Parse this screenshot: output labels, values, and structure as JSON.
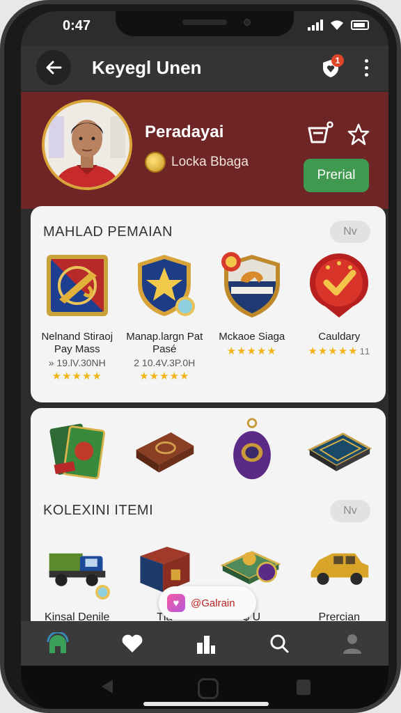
{
  "status": {
    "time": "0:47"
  },
  "appbar": {
    "title": "Keyegl Unen",
    "notification_count": "1"
  },
  "profile": {
    "name": "Peradayai",
    "coin_label": "Locka Bbaga",
    "premium_button": "Prerial"
  },
  "section1": {
    "title": "MAHLAD PEMAIAN",
    "toggle": "Nv",
    "items": [
      {
        "name": "Nelnand Stiraoj Pay Mass",
        "price": "» 19.lV.30NH",
        "stars": "★★★★★",
        "count": "",
        "icon": "saxophone-badge-icon"
      },
      {
        "name": "Manap.largn Pat Pasé",
        "price": "2 10.4V.3P.0H",
        "stars": "★★★★★",
        "count": "",
        "icon": "star-shield-icon"
      },
      {
        "name": "Mckaoe Siaga",
        "price": "",
        "stars": "★★★★★",
        "count": "",
        "icon": "crest-shield-icon"
      },
      {
        "name": "Cauldary",
        "price": "",
        "stars": "★★★★★",
        "count": "11",
        "icon": "check-badge-icon"
      }
    ]
  },
  "section2": {
    "title": "KOLEXINI ITEMI",
    "toggle": "Nv",
    "top_icons": [
      "card-pack-icon",
      "leather-book-icon",
      "purple-egg-icon",
      "board-game-icon"
    ],
    "bottom_icons": [
      "truck-icon",
      "treasure-box-icon",
      "money-stack-icon",
      "gold-car-icon"
    ],
    "bottom_names": [
      "Kinsal Denile",
      "Tla",
      "$ U",
      "Prercian"
    ]
  },
  "toast": {
    "label": "@Galrain"
  },
  "nav": [
    "home-icon",
    "heart-icon",
    "rank-icon",
    "search-icon",
    "profile-icon"
  ],
  "colors": {
    "header_bg": "#6d2525",
    "accent_green": "#3f9a4f",
    "star": "#f2b418"
  }
}
